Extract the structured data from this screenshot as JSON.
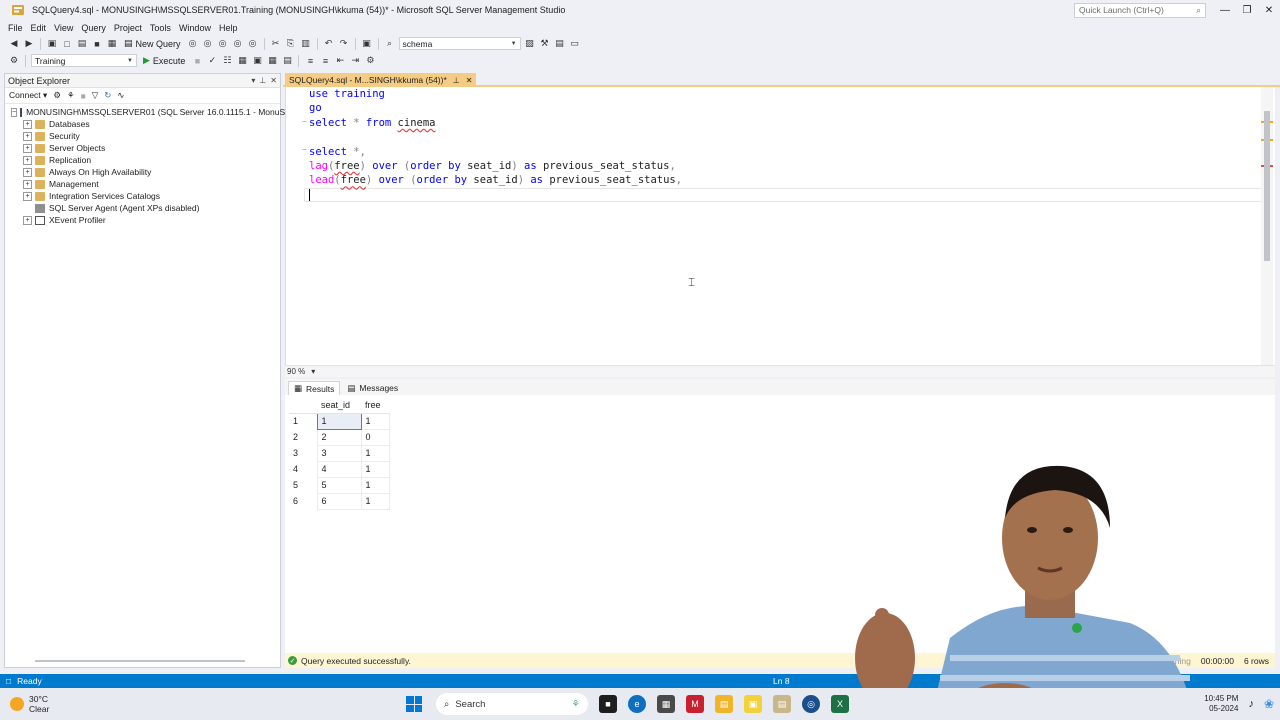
{
  "window": {
    "title": "SQLQuery4.sql - MONUSINGH\\MSSQLSERVER01.Training (MONUSINGH\\kkuma (54))* - Microsoft SQL Server Management Studio",
    "quick_launch_placeholder": "Quick Launch (Ctrl+Q)"
  },
  "menu": [
    "File",
    "Edit",
    "View",
    "Query",
    "Project",
    "Tools",
    "Window",
    "Help"
  ],
  "toolbar": {
    "new_query": "New Query",
    "search_combo": "schema",
    "database_combo": "Training",
    "execute": "Execute"
  },
  "object_explorer": {
    "title": "Object Explorer",
    "connect": "Connect",
    "server": "MONUSINGH\\MSSQLSERVER01 (SQL Server 16.0.1115.1 - MonuSingh\\",
    "nodes": [
      "Databases",
      "Security",
      "Server Objects",
      "Replication",
      "Always On High Availability",
      "Management",
      "Integration Services Catalogs",
      "SQL Server Agent (Agent XPs disabled)",
      "XEvent Profiler"
    ]
  },
  "editor": {
    "tab_title": "SQLQuery4.sql - M...SINGH\\kkuma (54))*",
    "zoom": "90 %",
    "code": [
      "use training",
      "go",
      "select * from cinema",
      "",
      "select *,",
      "lag(free) over (order by seat_id) as previous_seat_status,",
      "lead(free) over (order by seat_id) as previous_seat_status,",
      ""
    ]
  },
  "results": {
    "tabs": [
      "Results",
      "Messages"
    ],
    "columns": [
      "seat_id",
      "free"
    ],
    "rows": [
      [
        "1",
        "1",
        "1"
      ],
      [
        "2",
        "2",
        "0"
      ],
      [
        "3",
        "3",
        "1"
      ],
      [
        "4",
        "4",
        "1"
      ],
      [
        "5",
        "5",
        "1"
      ],
      [
        "6",
        "6",
        "1"
      ]
    ]
  },
  "query_status": {
    "message": "Query executed successfully.",
    "right_partial": "ning",
    "elapsed": "00:00:00",
    "rows": "6 rows"
  },
  "status_bar": {
    "ready": "Ready",
    "line": "Ln 8",
    "col_partial": "C"
  },
  "taskbar": {
    "temperature": "30°C",
    "weather": "Clear",
    "search": "Search",
    "time": "10:45 PM",
    "date": "05-2024"
  }
}
